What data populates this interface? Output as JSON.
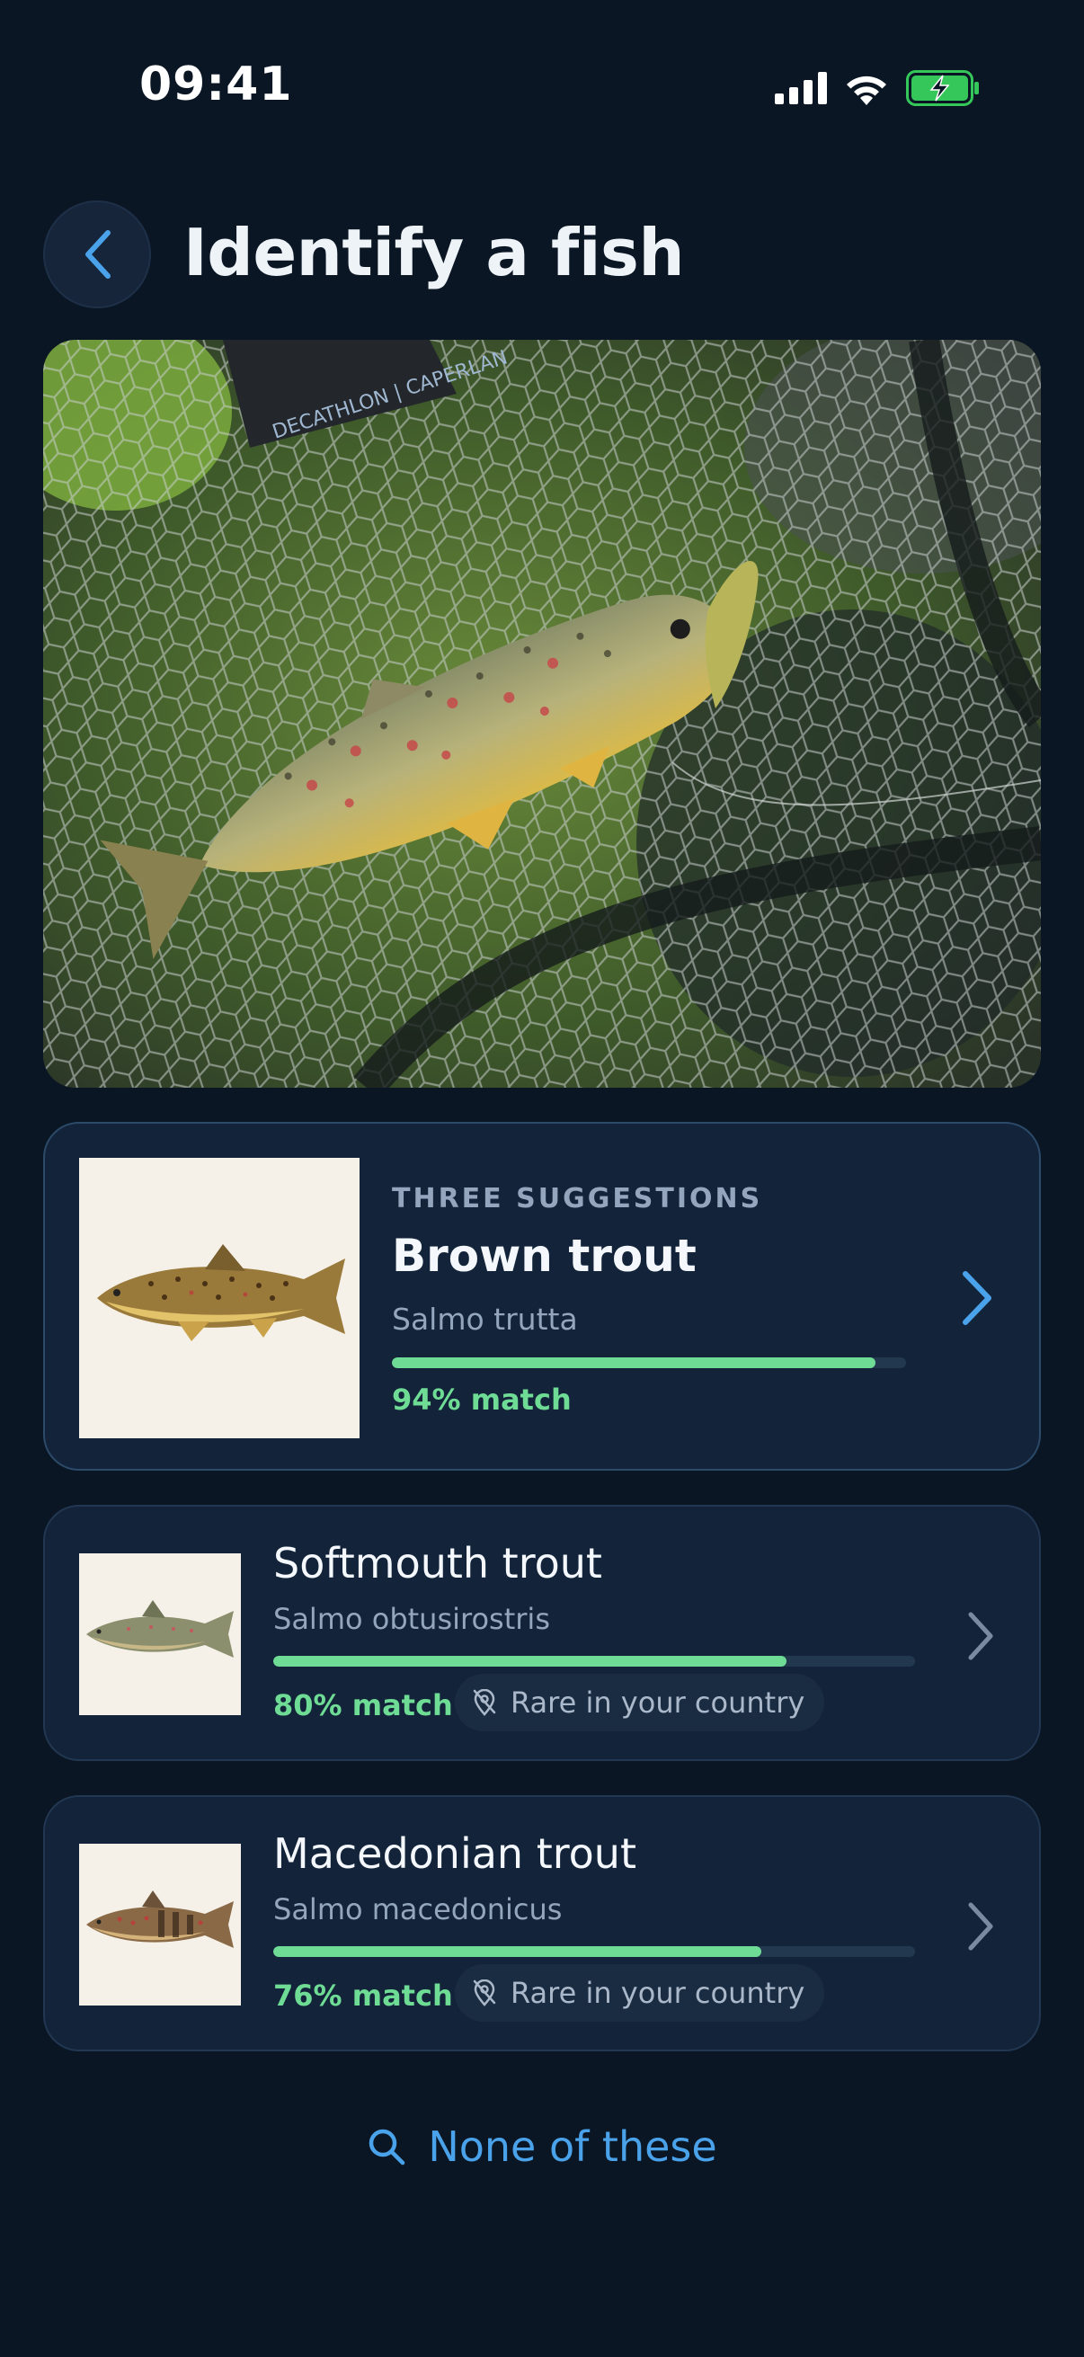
{
  "status_bar": {
    "time": "09:41",
    "icons": [
      "signal-icon",
      "wifi-icon",
      "battery-charging-icon"
    ]
  },
  "header": {
    "back_icon": "chevron-left-icon",
    "title": "Identify a fish"
  },
  "photo": {
    "net_brand_text": "DECATHLON | CAPERLAN"
  },
  "suggestions": {
    "label": "THREE SUGGESTIONS",
    "items": [
      {
        "name": "Brown trout",
        "scientific_name": "Salmo trutta",
        "match_percent": 94,
        "match_label": "94% match",
        "rare_label": ""
      },
      {
        "name": "Softmouth trout",
        "scientific_name": "Salmo obtusirostris",
        "match_percent": 80,
        "match_label": "80% match",
        "rare_label": "Rare in your country"
      },
      {
        "name": "Macedonian trout",
        "scientific_name": "Salmo macedonicus",
        "match_percent": 76,
        "match_label": "76% match",
        "rare_label": "Rare in your country"
      }
    ]
  },
  "footer": {
    "none_label": "None of these",
    "search_icon": "search-icon"
  },
  "colors": {
    "background": "#0b1624",
    "card": "#13243a",
    "accent_blue": "#4aa3ea",
    "match_green": "#6fdc95",
    "battery_green": "#35c759"
  }
}
